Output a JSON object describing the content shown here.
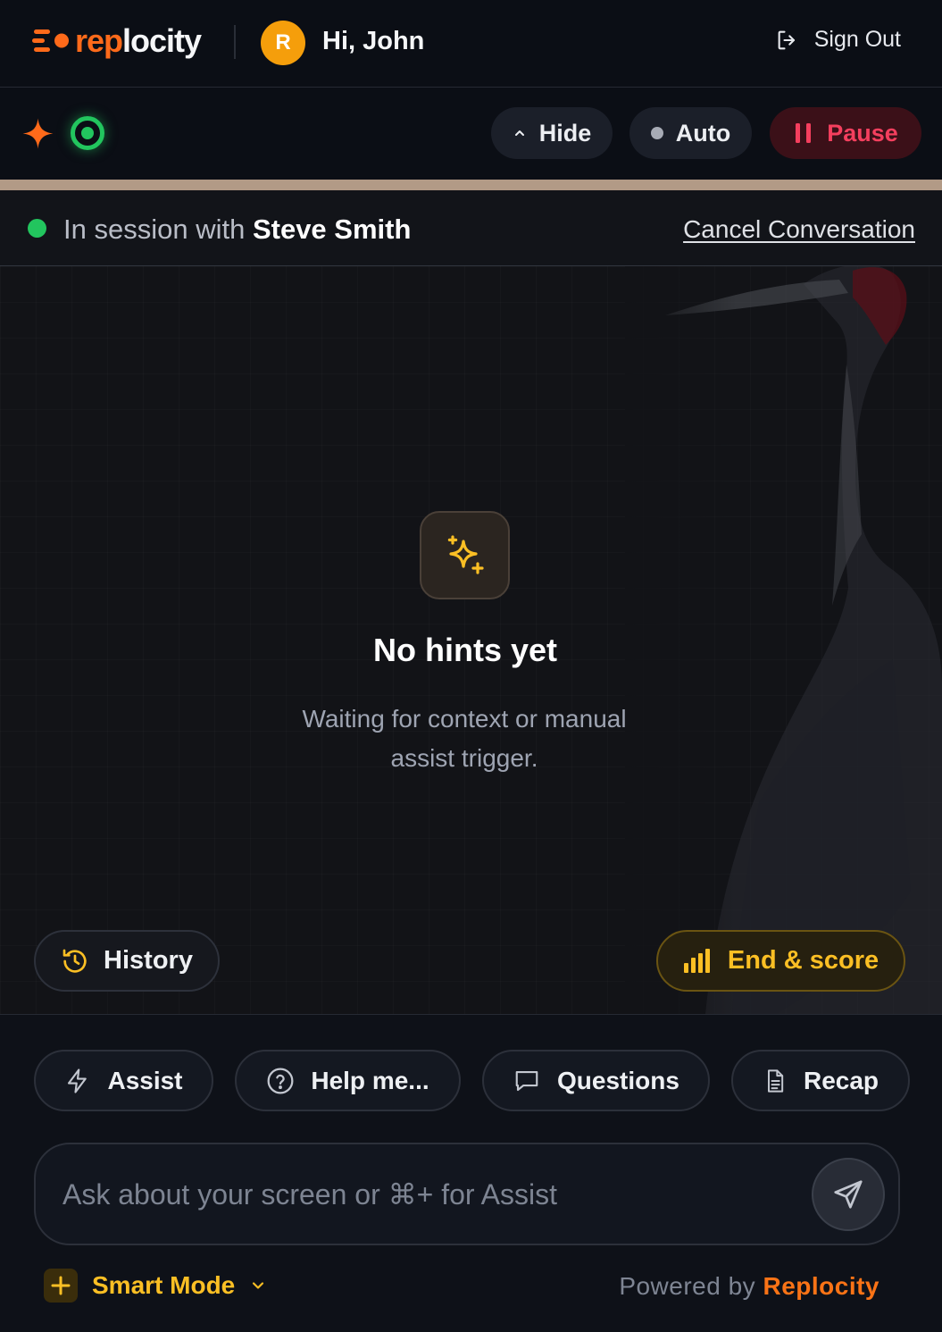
{
  "header": {
    "logo": {
      "part1": "rep",
      "part2": "locity"
    },
    "avatar_initial": "R",
    "greeting": "Hi, John",
    "sign_out_label": "Sign Out"
  },
  "controls": {
    "hide_label": "Hide",
    "auto_label": "Auto",
    "pause_label": "Pause"
  },
  "session": {
    "prefix": "In session with",
    "contact_name": "Steve Smith",
    "cancel_label": "Cancel Conversation"
  },
  "empty_state": {
    "title": "No hints yet",
    "subtitle": "Waiting for context or manual assist trigger."
  },
  "main_actions": {
    "history_label": "History",
    "end_score_label": "End & score"
  },
  "quick_actions": [
    {
      "label": "Assist",
      "icon": "lightning-icon"
    },
    {
      "label": "Help me...",
      "icon": "question-circle-icon"
    },
    {
      "label": "Questions",
      "icon": "chat-bubble-icon"
    },
    {
      "label": "Recap",
      "icon": "document-icon"
    }
  ],
  "composer": {
    "placeholder": "Ask about your screen or ⌘+ for Assist"
  },
  "footer": {
    "mode_label": "Smart Mode",
    "powered_prefix": "Powered by",
    "powered_brand": "Replocity"
  },
  "colors": {
    "brand_orange": "#ff6a1a",
    "live_green": "#22c55e",
    "pause_red": "#f43f5e",
    "accent_amber": "#fbbf24",
    "background": "#0b0e15"
  }
}
